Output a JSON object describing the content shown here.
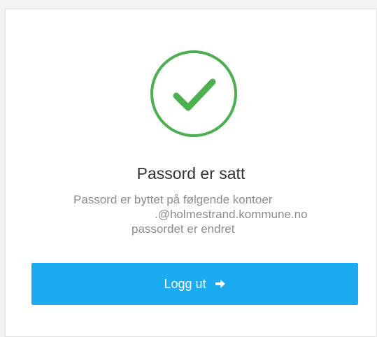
{
  "status": {
    "icon": "check-circle-icon",
    "color": "#4caf50"
  },
  "title": "Passord er satt",
  "message": {
    "line1": "Passord er byttet på følgende kontoer",
    "line2": ".@holmestrand.kommune.no",
    "line3": "passordet er endret"
  },
  "logout": {
    "label": "Logg ut",
    "icon": "arrow-right-icon",
    "color": "#1aabf0"
  }
}
